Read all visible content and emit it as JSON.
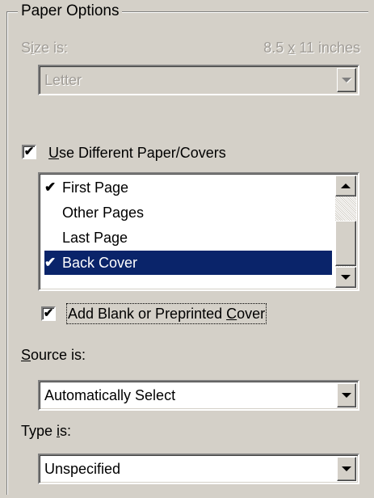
{
  "group": {
    "title": "Paper Options"
  },
  "size": {
    "label_pre": "S",
    "label_hotkey": "i",
    "label_post": "ze is:",
    "dimensions_pre": "8.5 ",
    "dimensions_hotkey": "x",
    "dimensions_post": " 11 inches",
    "selected": "Letter"
  },
  "different_paper": {
    "checked": true,
    "check_glyph": "✔",
    "label_hotkey": "U",
    "label_rest": "se Different Paper/Covers"
  },
  "pages_list": {
    "items": [
      {
        "label": "First Page",
        "tick": "✔",
        "selected": false
      },
      {
        "label": "Other Pages",
        "tick": "",
        "selected": false
      },
      {
        "label": "Last Page",
        "tick": "",
        "selected": false
      },
      {
        "label": "Back Cover",
        "tick": "✔",
        "selected": true
      }
    ]
  },
  "blank_cover": {
    "checked": true,
    "check_glyph": "✔",
    "label_pre": "Add Blank or Preprinted ",
    "label_hotkey": "C",
    "label_post": "over"
  },
  "source": {
    "label_hotkey": "S",
    "label_rest": "ource is:",
    "selected": "Automatically Select"
  },
  "type": {
    "label_pre": "Type ",
    "label_hotkey": "i",
    "label_post": "s:",
    "selected": "Unspecified"
  },
  "colors": {
    "selection": "#0a246a",
    "face": "#d4d0c8",
    "disabled_text": "#a09c96"
  }
}
